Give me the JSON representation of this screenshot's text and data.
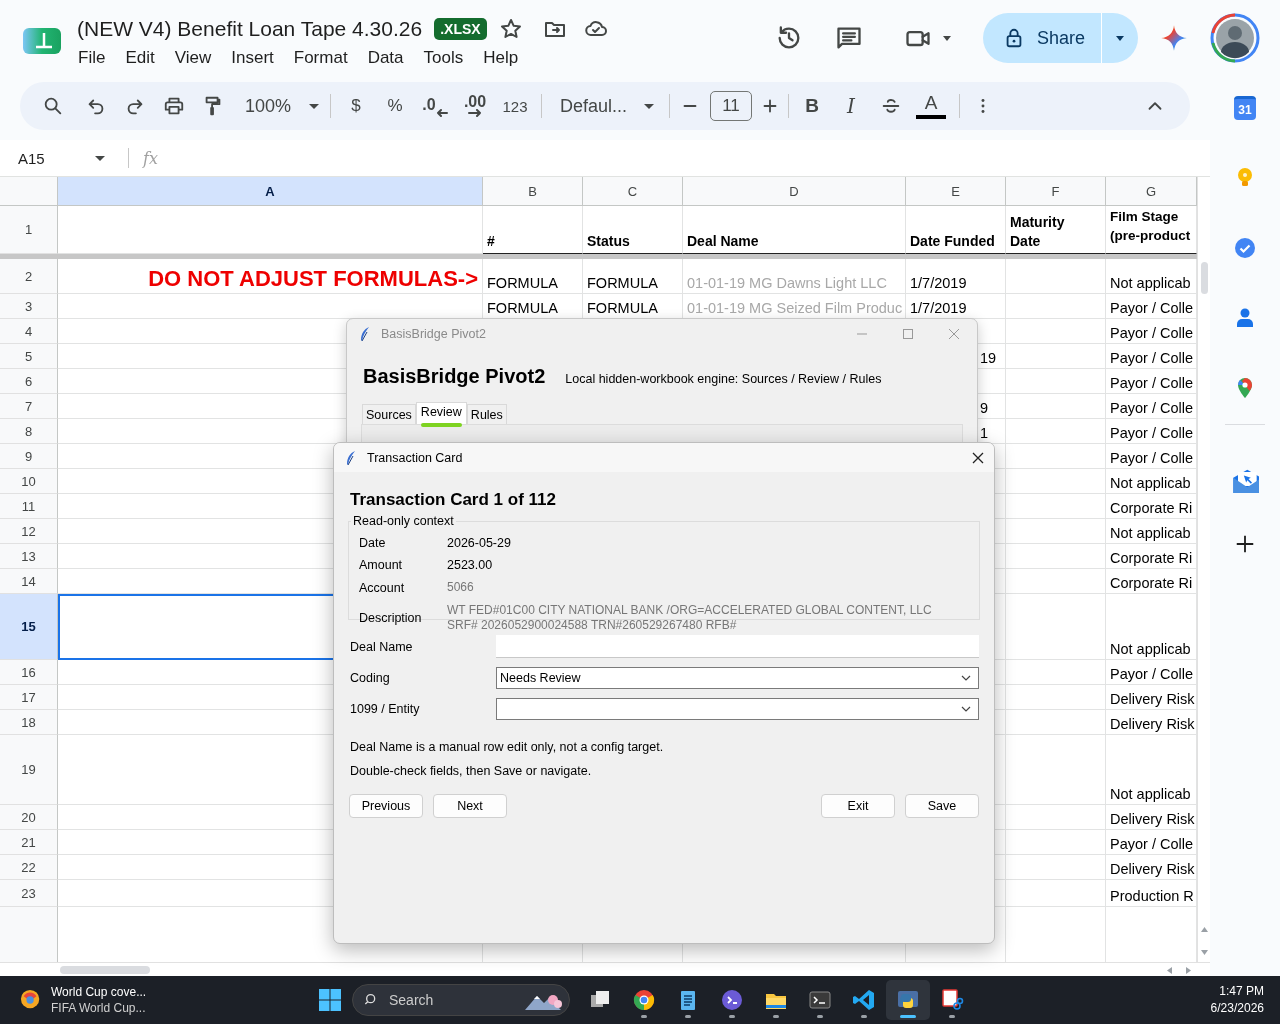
{
  "document": {
    "title": "(NEW V4) Benefit Loan Tape 4.30.26",
    "badge": ".XLSX",
    "menu": [
      "File",
      "Edit",
      "View",
      "Insert",
      "Format",
      "Data",
      "Tools",
      "Help"
    ]
  },
  "header_actions": {
    "share_label": "Share"
  },
  "toolbar": {
    "zoom": "100%",
    "currency": "$",
    "percent": "%",
    "decrease_decimal": ".0",
    "increase_decimal": ".00",
    "more_formats": "123",
    "font": "Defaul...",
    "font_size": "11",
    "bold": "B",
    "italic": "I",
    "text_color": "A"
  },
  "formula_bar": {
    "cell_ref": "A15",
    "fx": "fx"
  },
  "sheet": {
    "columns": [
      {
        "label": "A",
        "selected": true
      },
      {
        "label": "B",
        "selected": false
      },
      {
        "label": "C",
        "selected": false
      },
      {
        "label": "D",
        "selected": false
      },
      {
        "label": "E",
        "selected": false
      },
      {
        "label": "F",
        "selected": false
      },
      {
        "label": "G",
        "selected": false
      }
    ],
    "rows": [
      {
        "number": "1",
        "kind": "header",
        "selected": false,
        "cells": [
          "",
          "#",
          "Status",
          "Deal Name",
          "Date Funded",
          "Maturity\nDate",
          "Film Stage\n(pre-product"
        ]
      },
      {
        "number": "2",
        "kind": "data",
        "selected": false,
        "cells": [
          {
            "text": "DO NOT ADJUST FORMULAS->",
            "kind": "alert"
          },
          "FORMULA",
          "FORMULA",
          {
            "text": "01-01-19 MG Dawns Light LLC",
            "kind": "faded"
          },
          "1/7/2019",
          "",
          "Not applicab"
        ]
      },
      {
        "number": "3",
        "kind": "data",
        "selected": false,
        "cells": [
          "",
          "FORMULA",
          "FORMULA",
          {
            "text": "01-01-19 MG Seized Film Produc",
            "kind": "faded"
          },
          "1/7/2019",
          "",
          "Payor / Colle"
        ]
      },
      {
        "number": "4",
        "kind": "data",
        "selected": false,
        "cells": [
          "",
          "",
          "",
          "",
          "",
          "",
          "Payor / Colle"
        ]
      },
      {
        "number": "5",
        "kind": "data",
        "selected": false,
        "cells": [
          "",
          "",
          "",
          "",
          {
            "text": "19",
            "kind": "cut"
          },
          "",
          "Payor / Colle"
        ]
      },
      {
        "number": "6",
        "kind": "data",
        "selected": false,
        "cells": [
          "",
          "",
          "",
          "",
          "",
          "",
          "Payor / Colle"
        ]
      },
      {
        "number": "7",
        "kind": "data",
        "selected": false,
        "cells": [
          "",
          "",
          "",
          "",
          {
            "text": "9",
            "kind": "cut"
          },
          "",
          "Payor / Colle"
        ]
      },
      {
        "number": "8",
        "kind": "data",
        "selected": false,
        "cells": [
          "",
          "",
          "",
          "",
          {
            "text": "1",
            "kind": "cut"
          },
          "",
          "Payor / Colle"
        ]
      },
      {
        "number": "9",
        "kind": "data",
        "selected": false,
        "cells": [
          "",
          "",
          "",
          "",
          "",
          "",
          "Payor / Colle"
        ]
      },
      {
        "number": "10",
        "kind": "data",
        "selected": false,
        "cells": [
          "",
          "",
          "",
          "",
          "",
          "",
          "Not applicab"
        ]
      },
      {
        "number": "11",
        "kind": "data",
        "selected": false,
        "cells": [
          "",
          "",
          "",
          "",
          "",
          "",
          "Corporate Ri"
        ]
      },
      {
        "number": "12",
        "kind": "data",
        "selected": false,
        "cells": [
          "",
          "",
          "",
          "",
          "",
          "",
          "Not applicab"
        ]
      },
      {
        "number": "13",
        "kind": "data",
        "selected": false,
        "cells": [
          "",
          "",
          "",
          "",
          "",
          "",
          "Corporate Ri"
        ]
      },
      {
        "number": "14",
        "kind": "data",
        "selected": false,
        "cells": [
          "",
          "",
          "",
          "",
          "",
          "",
          "Corporate Ri"
        ]
      },
      {
        "number": "15",
        "kind": "data",
        "selected": true,
        "cells": [
          "",
          "",
          "",
          "",
          "",
          "",
          "Not applicab"
        ]
      },
      {
        "number": "16",
        "kind": "data",
        "selected": false,
        "cells": [
          "",
          "",
          "",
          "",
          "",
          "",
          "Payor / Colle"
        ]
      },
      {
        "number": "17",
        "kind": "data",
        "selected": false,
        "cells": [
          "",
          "",
          "",
          "",
          "",
          "",
          "Delivery Risk"
        ]
      },
      {
        "number": "18",
        "kind": "data",
        "selected": false,
        "cells": [
          "",
          "",
          "",
          "",
          "",
          "",
          "Delivery Risk"
        ]
      },
      {
        "number": "19",
        "kind": "data",
        "selected": false,
        "cells": [
          "",
          "",
          "",
          "",
          "",
          "",
          "Not applicab"
        ]
      },
      {
        "number": "20",
        "kind": "data",
        "selected": false,
        "cells": [
          "",
          "",
          "",
          "",
          "",
          "",
          "Delivery Risk"
        ]
      },
      {
        "number": "21",
        "kind": "data",
        "selected": false,
        "cells": [
          "",
          "",
          "",
          "",
          "",
          "",
          "Payor / Colle"
        ]
      },
      {
        "number": "22",
        "kind": "data",
        "selected": false,
        "cells": [
          "",
          "",
          "",
          "",
          "",
          "",
          "Delivery Risk"
        ]
      },
      {
        "number": "23",
        "kind": "data",
        "selected": false,
        "cells": [
          "",
          "",
          "",
          "",
          "",
          "",
          "Production R"
        ]
      }
    ]
  },
  "side_panel": {
    "calendar_day": "31"
  },
  "pivot": {
    "title": "BasisBridge Pivot2",
    "heading": "BasisBridge Pivot2",
    "subtitle": "Local hidden-workbook engine: Sources / Review / Rules",
    "tabs": [
      {
        "label": "Sources",
        "selected": false
      },
      {
        "label": "Review",
        "selected": true
      },
      {
        "label": "Rules",
        "selected": false
      }
    ]
  },
  "card": {
    "title": "Transaction Card",
    "heading": "Transaction Card 1 of 112",
    "context_legend": "Read-only context",
    "context": [
      {
        "label": "Date",
        "value": "2026-05-29"
      },
      {
        "label": "Amount",
        "value": "2523.00"
      },
      {
        "label": "Account",
        "value": "5066",
        "faded": true
      },
      {
        "label": "Description",
        "value": "WT FED#01C00 CITY NATIONAL BANK /ORG=ACCELERATED GLOBAL CONTENT, LLC\nSRF# 2026052900024588 TRN#260529267480 RFB#",
        "faded": true
      }
    ],
    "form": [
      {
        "label": "Deal Name",
        "kind": "text"
      },
      {
        "label": "Coding",
        "kind": "select",
        "value": "Needs Review"
      },
      {
        "label": "1099 / Entity",
        "kind": "select"
      }
    ],
    "notes": [
      "Deal Name is a manual row edit only, not a config target.",
      "Double-check fields, then Save or navigate."
    ],
    "buttons_left": [
      "Previous",
      "Next"
    ],
    "buttons_right": [
      "Exit",
      "Save"
    ]
  },
  "taskbar": {
    "news_title": "World Cup cove...",
    "news_subtitle": "FIFA World Cup...",
    "search": "Search",
    "apps": [
      {
        "kind": "taskview",
        "running": false,
        "selected": false
      },
      {
        "kind": "browser",
        "running": true,
        "selected": false
      },
      {
        "kind": "notepad",
        "running": true,
        "selected": false
      },
      {
        "kind": "chat",
        "running": true,
        "selected": false
      },
      {
        "kind": "explorer",
        "running": true,
        "selected": false
      },
      {
        "kind": "terminal",
        "running": true,
        "selected": false
      },
      {
        "kind": "code",
        "running": true,
        "selected": false
      },
      {
        "kind": "python",
        "running": true,
        "selected": true
      },
      {
        "kind": "snip",
        "running": true,
        "selected": false
      }
    ],
    "time": "1:47 PM",
    "date": "6/23/2026"
  }
}
